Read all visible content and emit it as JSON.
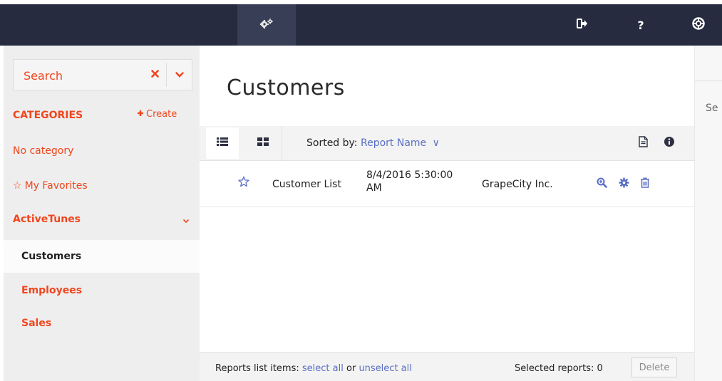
{
  "topbar": {
    "icons": [
      "settings-icon",
      "logout-icon",
      "help-icon",
      "support-icon"
    ],
    "help_glyph": "?"
  },
  "sidebar": {
    "search": {
      "placeholder": "Search"
    },
    "categories_label": "CATEGORIES",
    "create_label": "Create",
    "items": [
      {
        "label": "No category",
        "icon": ""
      },
      {
        "label": "My Favorites",
        "icon": "star-icon",
        "glyph": "☆"
      },
      {
        "label": "ActiveTunes",
        "icon": "chevron-down-icon"
      },
      {
        "label": "Customers",
        "active": true
      },
      {
        "label": "Employees"
      },
      {
        "label": "Sales"
      }
    ]
  },
  "main": {
    "title": "Customers",
    "toolbar": {
      "sorted_prefix": "Sorted by:",
      "sorted_value": "Report Name",
      "sorted_chevron": "∨"
    },
    "rows": [
      {
        "name": "Customer List",
        "date_line1": "8/4/2016 5:30:00",
        "date_line2": "AM",
        "company": "GrapeCity Inc."
      }
    ],
    "footer": {
      "prefix": "Reports list items:",
      "select_all": "select all",
      "or": "or",
      "unselect_all": "unselect all",
      "selected_label": "Selected reports: 0",
      "delete_label": "Delete"
    }
  },
  "right_panel": {
    "text": "Se"
  },
  "colors": {
    "accent": "#f0461e",
    "link": "#5a6fc4",
    "topbar": "#262b3f"
  }
}
